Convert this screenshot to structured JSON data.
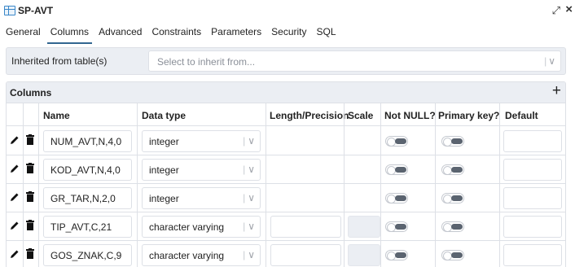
{
  "window": {
    "title": "SP-AVT"
  },
  "tabs": [
    {
      "label": "General"
    },
    {
      "label": "Columns"
    },
    {
      "label": "Advanced"
    },
    {
      "label": "Constraints"
    },
    {
      "label": "Parameters"
    },
    {
      "label": "Security"
    },
    {
      "label": "SQL"
    }
  ],
  "active_tab": "Columns",
  "inherit": {
    "label": "Inherited from table(s)",
    "placeholder": "Select to inherit from..."
  },
  "columns_grid": {
    "title": "Columns",
    "headers": {
      "name": "Name",
      "data_type": "Data type",
      "length": "Length/Precision",
      "scale": "Scale",
      "not_null": "Not NULL?",
      "primary_key": "Primary key?",
      "default": "Default"
    },
    "rows": [
      {
        "name": "NUM_AVT,N,4,0",
        "data_type": "integer",
        "length_editable": false,
        "not_null": false,
        "primary_key": false
      },
      {
        "name": "KOD_AVT,N,4,0",
        "data_type": "integer",
        "length_editable": false,
        "not_null": false,
        "primary_key": false
      },
      {
        "name": "GR_TAR,N,2,0",
        "data_type": "integer",
        "length_editable": false,
        "not_null": false,
        "primary_key": false
      },
      {
        "name": "TIP_AVT,C,21",
        "data_type": "character varying",
        "length_editable": true,
        "not_null": false,
        "primary_key": false
      },
      {
        "name": "GOS_ZNAK,C,9",
        "data_type": "character varying",
        "length_editable": true,
        "not_null": false,
        "primary_key": false
      }
    ]
  }
}
